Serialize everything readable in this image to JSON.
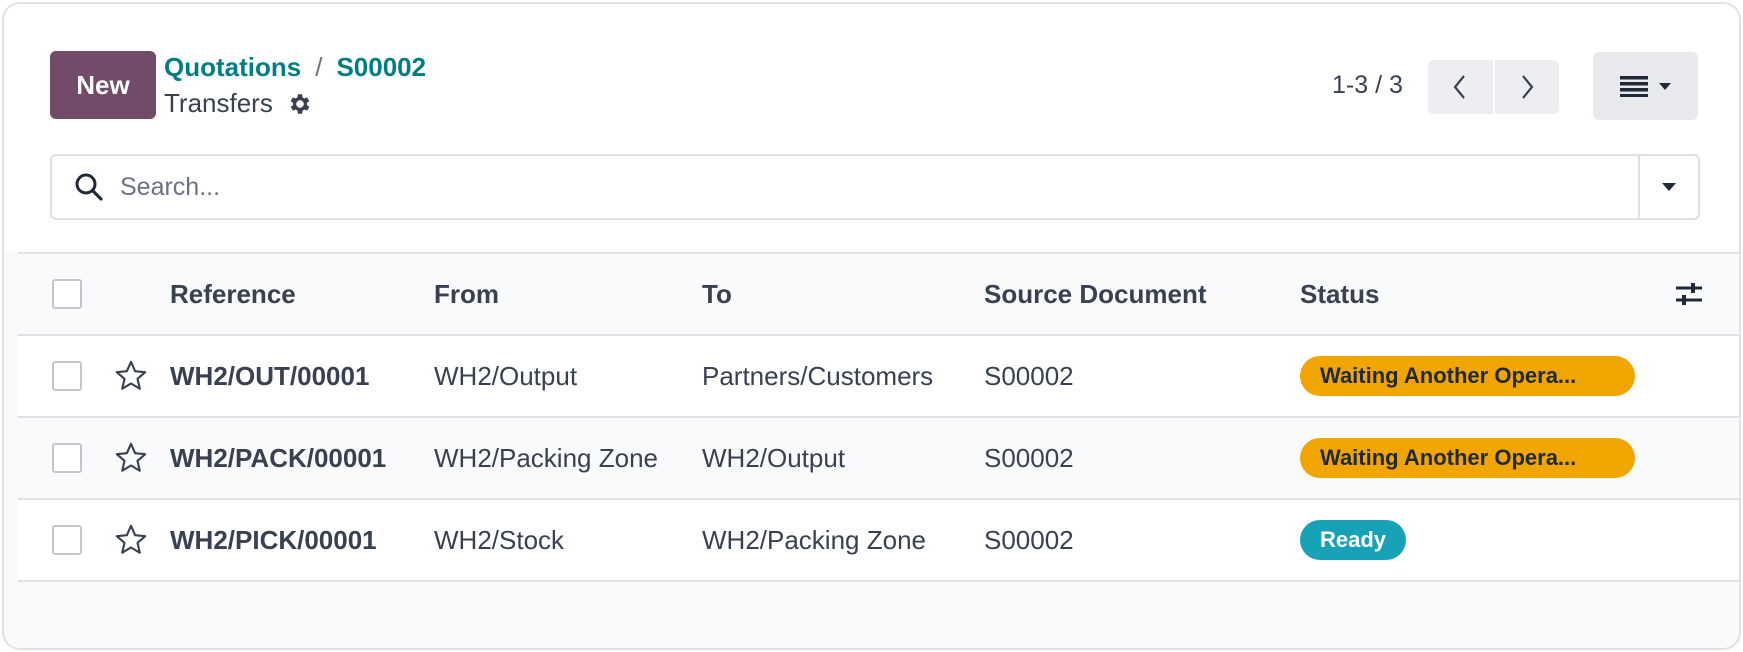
{
  "control_panel": {
    "new_button": "New",
    "breadcrumb": {
      "parent": "Quotations",
      "separator": "/",
      "record": "S00002"
    },
    "title": "Transfers",
    "pager": "1-3 / 3",
    "search": {
      "placeholder": "Search...",
      "value": ""
    }
  },
  "table": {
    "headers": {
      "reference": "Reference",
      "from": "From",
      "to": "To",
      "source_document": "Source Document",
      "status": "Status"
    },
    "rows": [
      {
        "reference": "WH2/OUT/00001",
        "from": "WH2/Output",
        "to": "Partners/Customers",
        "source_document": "S00002",
        "status": "Waiting Another Opera..."
      },
      {
        "reference": "WH2/PACK/00001",
        "from": "WH2/Packing Zone",
        "to": "WH2/Output",
        "source_document": "S00002",
        "status": "Waiting Another Opera..."
      },
      {
        "reference": "WH2/PICK/00001",
        "from": "WH2/Stock",
        "to": "WH2/Packing Zone",
        "source_document": "S00002",
        "status": "Ready"
      }
    ]
  },
  "colors": {
    "primary": "#714b67",
    "link": "#017e84",
    "status_waiting": "#f0a500",
    "status_ready": "#17a2b8"
  },
  "icons": [
    "gear-icon",
    "chevron-left-icon",
    "chevron-right-icon",
    "list-view-icon",
    "caret-down-icon",
    "search-icon",
    "star-icon",
    "optional-columns-icon"
  ]
}
